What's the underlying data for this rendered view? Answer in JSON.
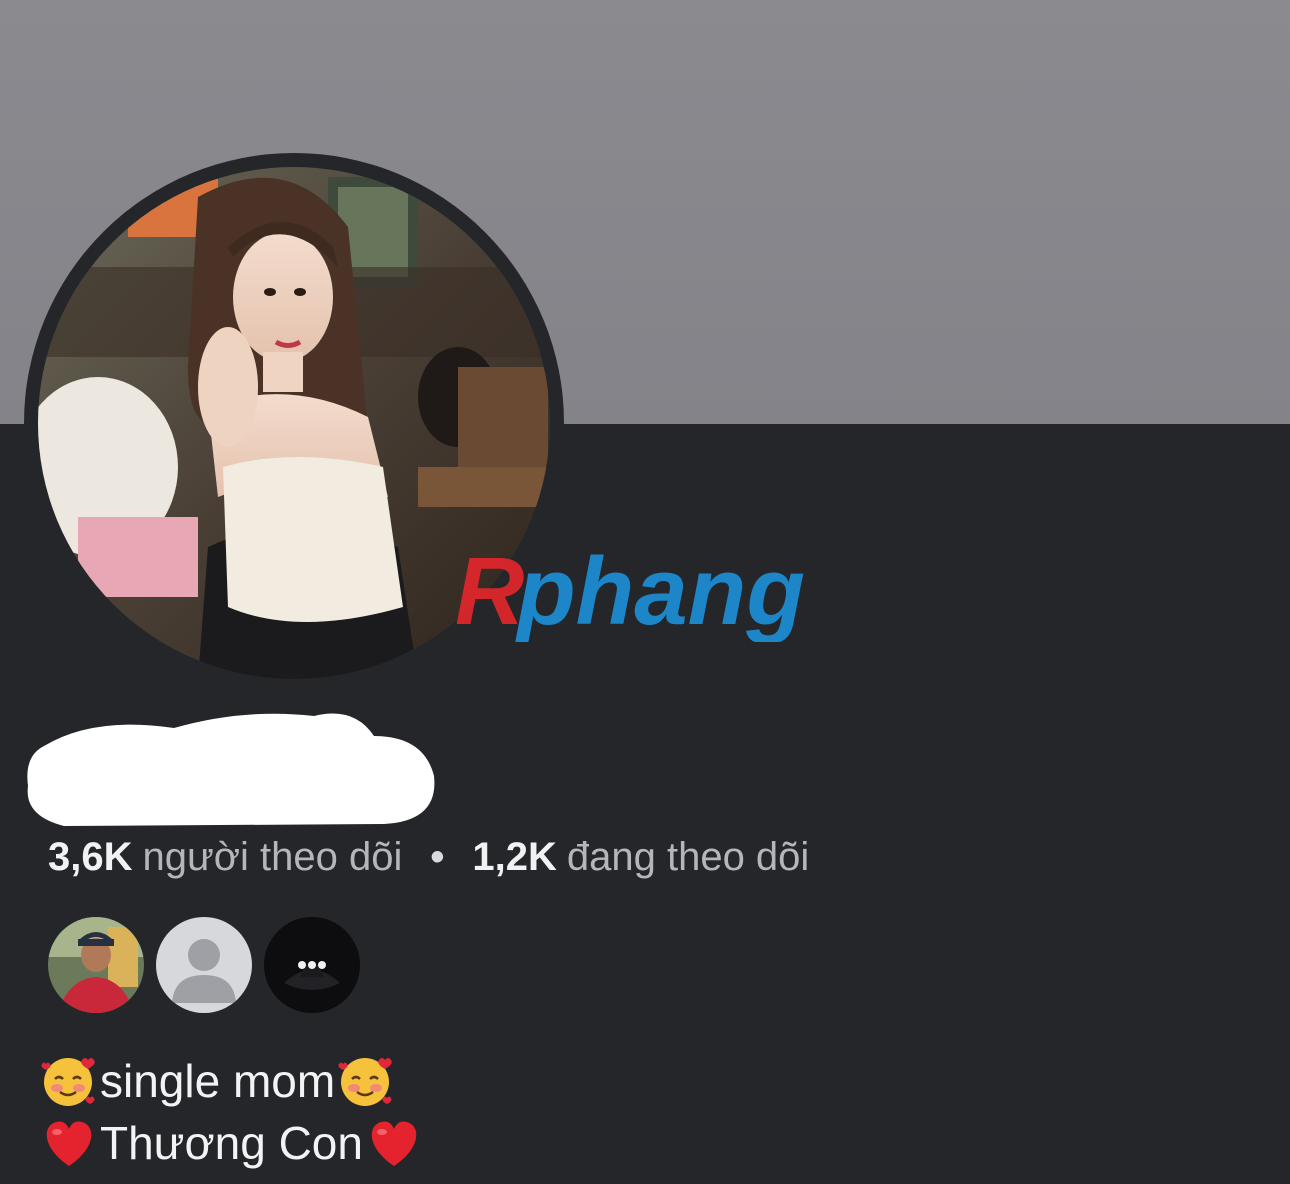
{
  "profile": {
    "avatar_icon": "profile-photo",
    "name_redacted": true,
    "stats": {
      "followers_count": "3,6K",
      "followers_label": "người theo dõi",
      "separator": "•",
      "following_count": "1,2K",
      "following_label": "đang theo dõi"
    },
    "mutual_friends": [
      {
        "icon": "friend-photo",
        "kind": "photo"
      },
      {
        "icon": "default-avatar-icon",
        "kind": "placeholder"
      },
      {
        "icon": "more-icon",
        "kind": "more",
        "label": "•••"
      }
    ],
    "bio": {
      "line1": {
        "emoji": "smiling-face-with-hearts",
        "text": "single mom"
      },
      "line2": {
        "emoji": "red-heart",
        "text": "Thương Con"
      }
    }
  },
  "watermark": {
    "text": "Rphang",
    "colors": [
      "#e2262c",
      "#1c8fd6"
    ]
  },
  "colors": {
    "cover": "#87878c",
    "background": "#24262a",
    "text_primary": "#f1f2f4",
    "text_secondary": "#b4b6bb"
  }
}
